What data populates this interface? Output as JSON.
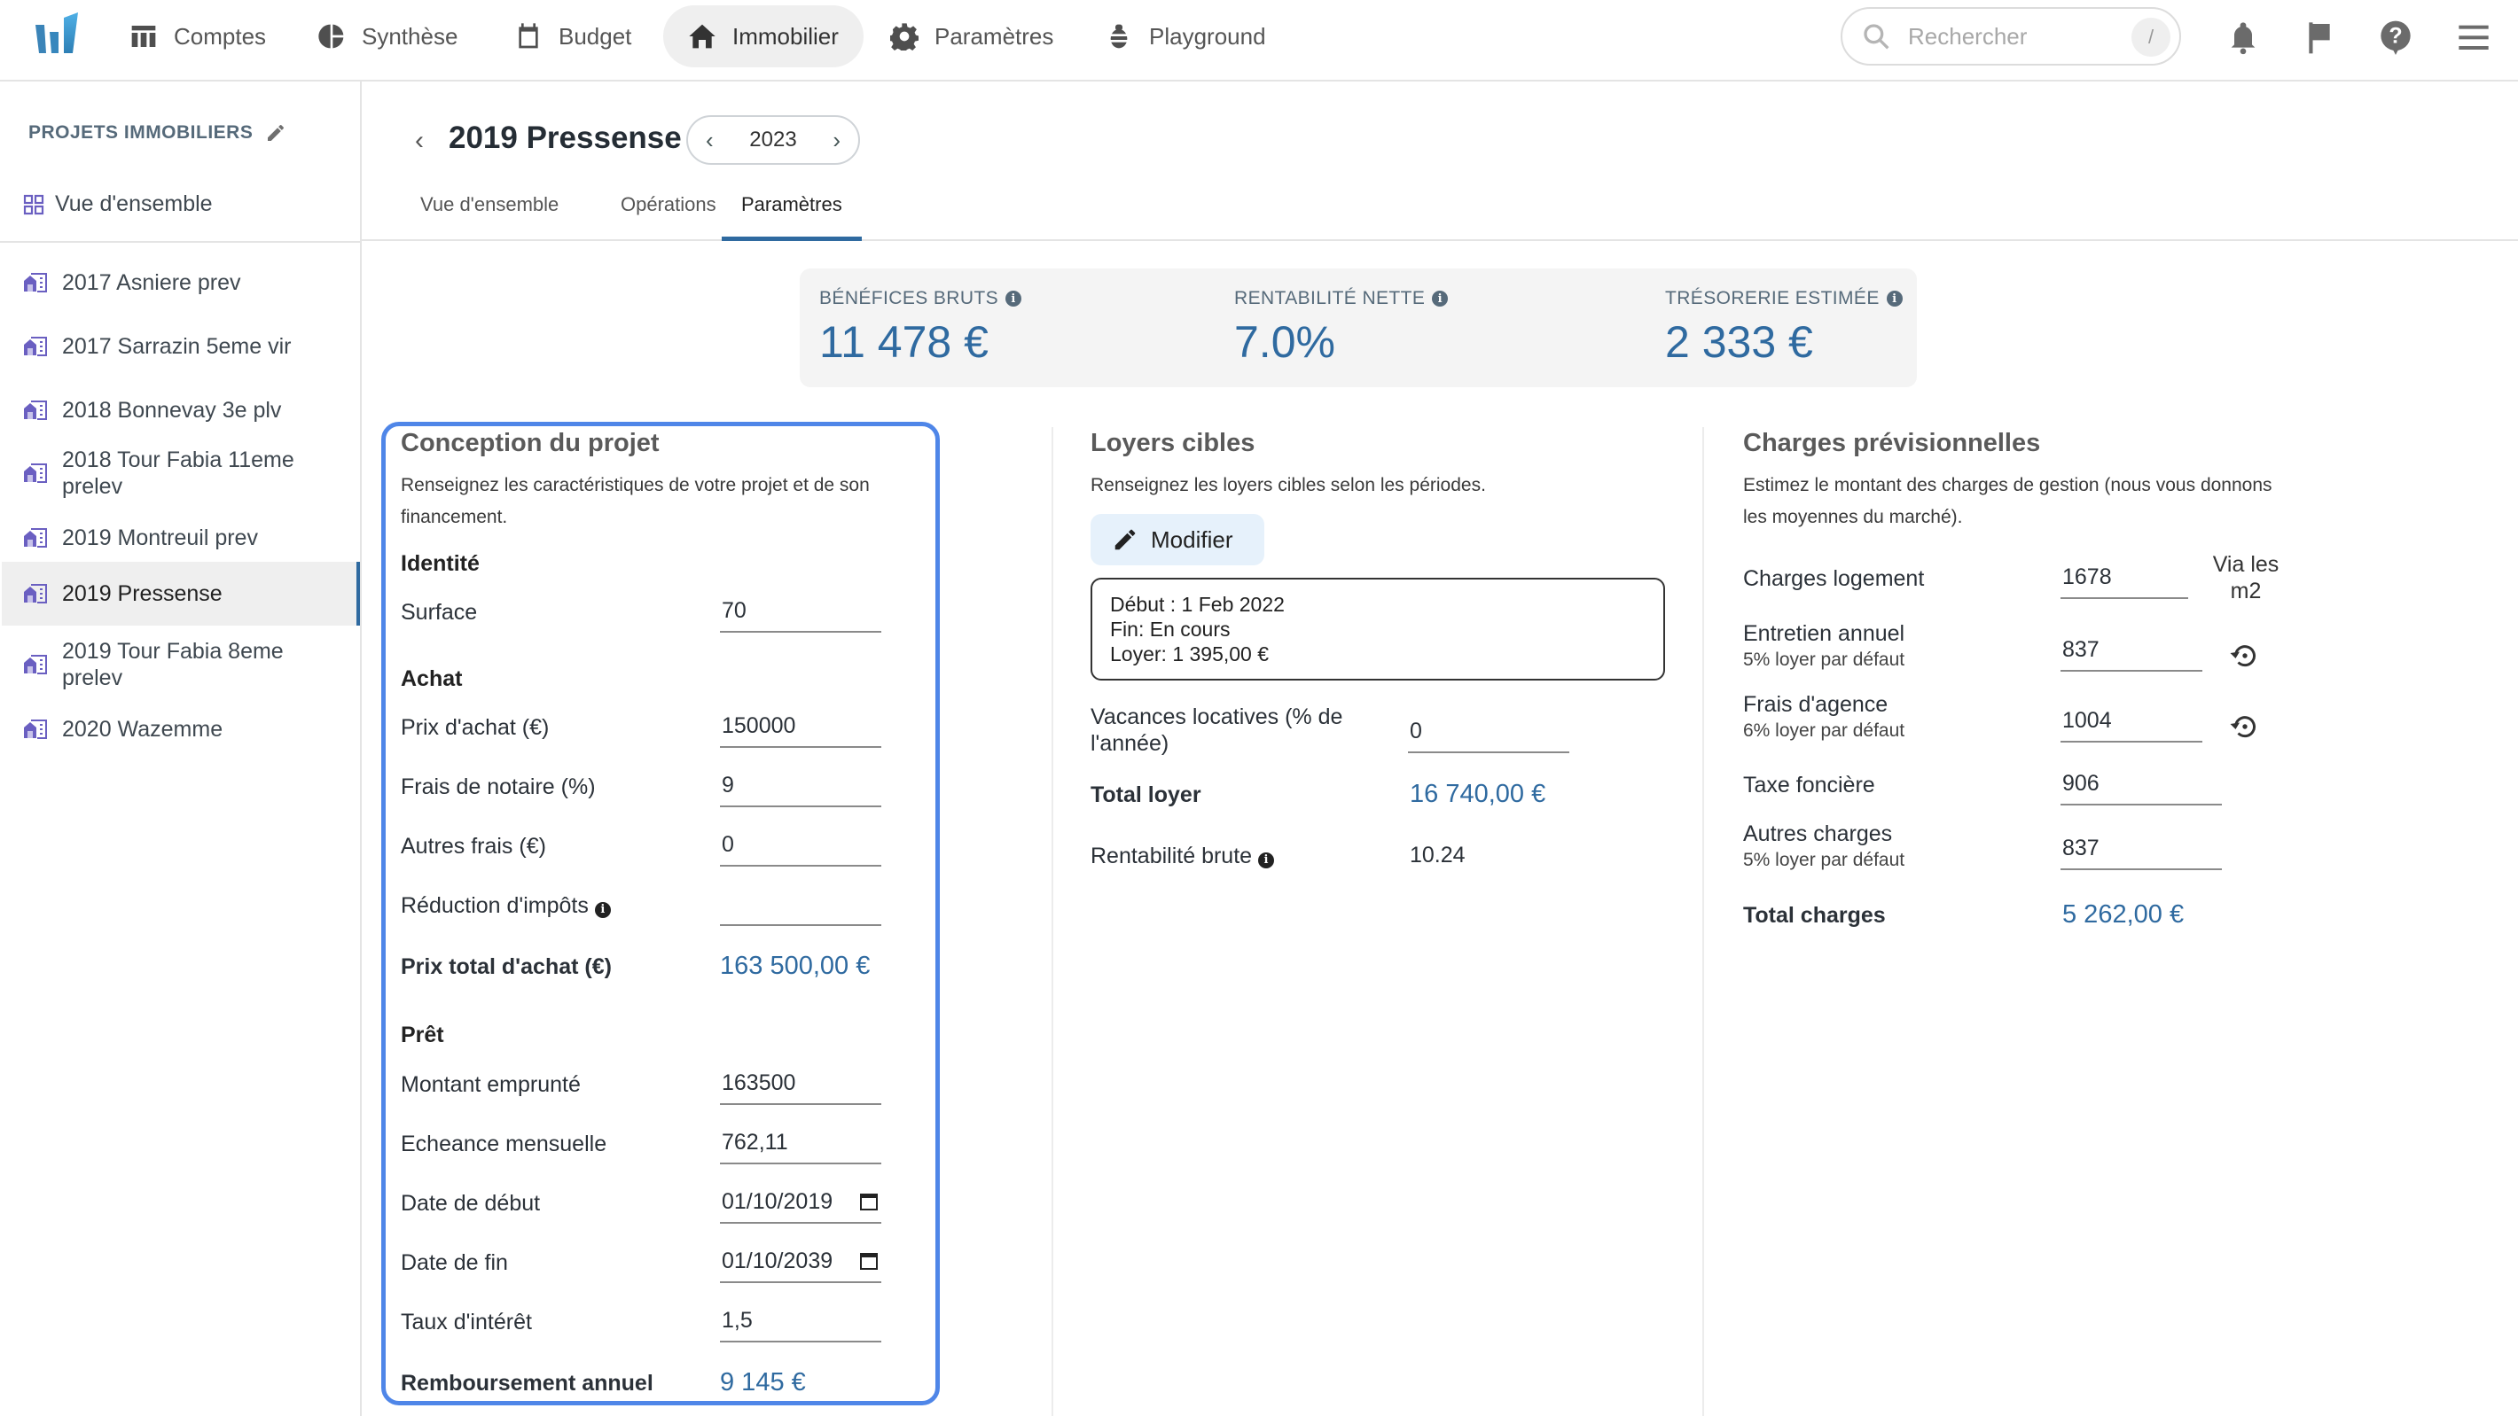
{
  "nav": {
    "items": [
      {
        "label": "Comptes",
        "icon": "table-icon"
      },
      {
        "label": "Synthèse",
        "icon": "pie-chart-icon"
      },
      {
        "label": "Budget",
        "icon": "calendar-icon"
      },
      {
        "label": "Immobilier",
        "icon": "home-icon",
        "active": true
      },
      {
        "label": "Paramètres",
        "icon": "gear-icon"
      },
      {
        "label": "Playground",
        "icon": "bug-icon"
      }
    ],
    "search_placeholder": "Rechercher",
    "search_shortcut": "/"
  },
  "sidebar": {
    "title": "PROJETS IMMOBILIERS",
    "overview": "Vue d'ensemble",
    "projects": [
      "2017 Asniere prev",
      "2017 Sarrazin 5eme vir",
      "2018 Bonnevay 3e plv",
      "2018 Tour Fabia 11eme prelev",
      "2019 Montreuil prev",
      "2019 Pressense",
      "2019 Tour Fabia 8eme prelev",
      "2020 Wazemme"
    ],
    "active_project": "2019 Pressense"
  },
  "header": {
    "title": "2019 Pressense",
    "year": "2023",
    "tabs": [
      "Vue d'ensemble",
      "Opérations",
      "Paramètres"
    ],
    "active_tab": "Paramètres"
  },
  "kpis": [
    {
      "label": "BÉNÉFICES BRUTS",
      "value": "11 478 €"
    },
    {
      "label": "RENTABILITÉ NETTE",
      "value": "7.0%"
    },
    {
      "label": "TRÉSORERIE ESTIMÉE",
      "value": "2 333 €"
    }
  ],
  "conception": {
    "title": "Conception du projet",
    "description": "Renseignez les caractéristiques de votre projet et de son financement.",
    "identite": {
      "heading": "Identité",
      "surface_label": "Surface",
      "surface_value": "70"
    },
    "achat": {
      "heading": "Achat",
      "prix_label": "Prix d'achat (€)",
      "prix_value": "150000",
      "notaire_label": "Frais de notaire (%)",
      "notaire_value": "9",
      "autres_label": "Autres frais (€)",
      "autres_value": "0",
      "reduction_label": "Réduction d'impôts",
      "reduction_value": "",
      "total_label": "Prix total d'achat (€)",
      "total_value": "163 500,00 €"
    },
    "pret": {
      "heading": "Prêt",
      "montant_label": "Montant emprunté",
      "montant_value": "163500",
      "echeance_label": "Echeance mensuelle",
      "echeance_value": "762,11",
      "debut_label": "Date de début",
      "debut_value": "01/10/2019",
      "fin_label": "Date de fin",
      "fin_value": "01/10/2039",
      "taux_label": "Taux d'intérêt",
      "taux_value": "1,5",
      "remboursement_label": "Remboursement annuel",
      "remboursement_value": "9 145 €"
    }
  },
  "loyers": {
    "title": "Loyers cibles",
    "description": "Renseignez les loyers cibles selon les périodes.",
    "modifier_label": "Modifier",
    "period": {
      "debut": "Début : 1 Feb 2022",
      "fin": "Fin: En cours",
      "loyer": "Loyer: 1 395,00 €"
    },
    "vacances_label": "Vacances locatives (% de l'année)",
    "vacances_value": "0",
    "total_label": "Total loyer",
    "total_value": "16 740,00 €",
    "rentabilite_label": "Rentabilité brute",
    "rentabilite_value": "10.24"
  },
  "charges": {
    "title": "Charges prévisionnelles",
    "description": "Estimez le montant des charges de gestion (nous vous donnons les moyennes du marché).",
    "logement_label": "Charges logement",
    "logement_value": "1678",
    "via_m2": "Via les m2",
    "entretien_label": "Entretien annuel",
    "entretien_sub": "5% loyer par défaut",
    "entretien_value": "837",
    "agence_label": "Frais d'agence",
    "agence_sub": "6% loyer par défaut",
    "agence_value": "1004",
    "taxe_label": "Taxe foncière",
    "taxe_value": "906",
    "autres_label": "Autres charges",
    "autres_sub": "5% loyer par défaut",
    "autres_value": "837",
    "total_label": "Total charges",
    "total_value": "5 262,00 €"
  },
  "colors": {
    "accent": "#2f6aa0",
    "focus_border": "#4f86e8",
    "project_icon": "#6a5fc1"
  }
}
